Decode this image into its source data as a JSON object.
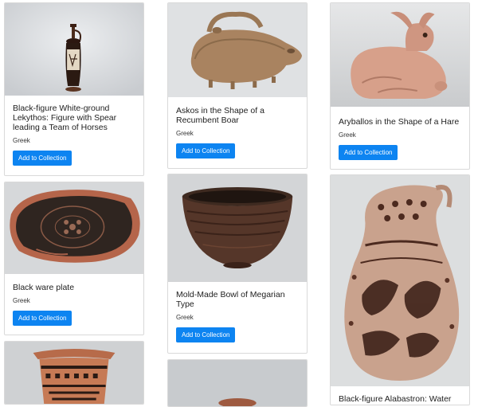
{
  "cards": [
    {
      "title": "Black-figure White-ground Lekythos: Figure with Spear leading a Team of Horses",
      "culture": "Greek",
      "button": "Add to Collection",
      "image": "lekythos-vase"
    },
    {
      "title": "Askos in the Shape of a Recumbent Boar",
      "culture": "Greek",
      "button": "Add to Collection",
      "image": "boar-askos"
    },
    {
      "title": "Aryballos in the Shape of a Hare",
      "culture": "Greek",
      "button": "Add to Collection",
      "image": "hare-aryballos"
    },
    {
      "title": "Black ware plate",
      "culture": "Greek",
      "button": "Add to Collection",
      "image": "black-ware-plate"
    },
    {
      "title": "Mold-Made Bowl of Megarian Type",
      "culture": "Greek",
      "button": "Add to Collection",
      "image": "megarian-bowl"
    },
    {
      "title": "Black-figure Alabastron: Water",
      "culture": "",
      "button": "",
      "image": "alabastron-jug"
    },
    {
      "title": "",
      "culture": "",
      "button": "",
      "image": "decorated-vase-partial"
    },
    {
      "title": "",
      "culture": "",
      "button": "",
      "image": "vessel-partial"
    }
  ]
}
